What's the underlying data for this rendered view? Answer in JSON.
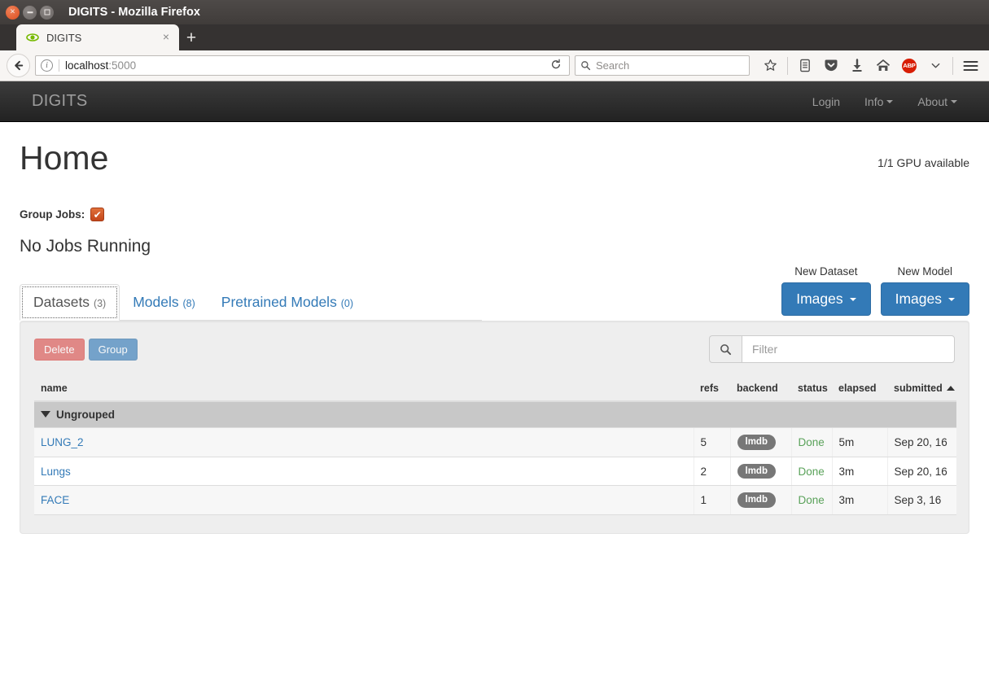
{
  "window": {
    "title": "DIGITS - Mozilla Firefox",
    "controls": {
      "close": "×",
      "minimize": "–",
      "maximize": "□"
    }
  },
  "browser": {
    "tab": {
      "title": "DIGITS",
      "favicon": "nvidia-eye-icon",
      "close_label": "×"
    },
    "new_tab_label": "+",
    "back_label": "←",
    "url": {
      "host": "localhost",
      "port": ":5000",
      "info_icon": "ⓘ"
    },
    "reload_label": "⟳",
    "search": {
      "placeholder": "Search",
      "icon": "search-icon"
    },
    "toolbar_icons": [
      "star-icon",
      "library-icon",
      "pocket-icon",
      "downloads-icon",
      "home-icon",
      "adblock-icon",
      "chevron-down-icon",
      "menu-icon"
    ],
    "adblock_label": "ABP"
  },
  "app_nav": {
    "brand": "DIGITS",
    "links": [
      {
        "label": "Login",
        "caret": false
      },
      {
        "label": "Info",
        "caret": true
      },
      {
        "label": "About",
        "caret": true
      }
    ]
  },
  "page": {
    "title": "Home",
    "gpu_status": "1/1 GPU available",
    "group_jobs_label": "Group Jobs:",
    "group_jobs_checked": true,
    "checkmark": "✔",
    "no_jobs_text": "No Jobs Running"
  },
  "tabs": [
    {
      "label": "Datasets",
      "count": "(3)",
      "active": true
    },
    {
      "label": "Models",
      "count": "(8)",
      "active": false
    },
    {
      "label": "Pretrained Models",
      "count": "(0)",
      "active": false
    }
  ],
  "new_actions": [
    {
      "label": "New Dataset",
      "button": "Images"
    },
    {
      "label": "New Model",
      "button": "Images"
    }
  ],
  "toolbar": {
    "delete_label": "Delete",
    "group_label": "Group",
    "filter_placeholder": "Filter",
    "filter_value": ""
  },
  "table": {
    "columns": [
      "name",
      "refs",
      "backend",
      "status",
      "elapsed",
      "submitted"
    ],
    "sorted_column": "submitted",
    "sort_direction": "asc",
    "group_label": "Ungrouped",
    "rows": [
      {
        "name": "LUNG_2",
        "refs": "5",
        "backend": "lmdb",
        "status": "Done",
        "elapsed": "5m",
        "submitted": "Sep 20, 16"
      },
      {
        "name": "Lungs",
        "refs": "2",
        "backend": "lmdb",
        "status": "Done",
        "elapsed": "3m",
        "submitted": "Sep 20, 16"
      },
      {
        "name": "FACE",
        "refs": "1",
        "backend": "lmdb",
        "status": "Done",
        "elapsed": "3m",
        "submitted": "Sep 3, 16"
      }
    ]
  },
  "colors": {
    "accent_blue": "#337ab7",
    "danger_red": "#d9534f",
    "status_green": "#5aa25a",
    "checkbox_orange": "#c3461b",
    "badge_gray": "#777777"
  }
}
